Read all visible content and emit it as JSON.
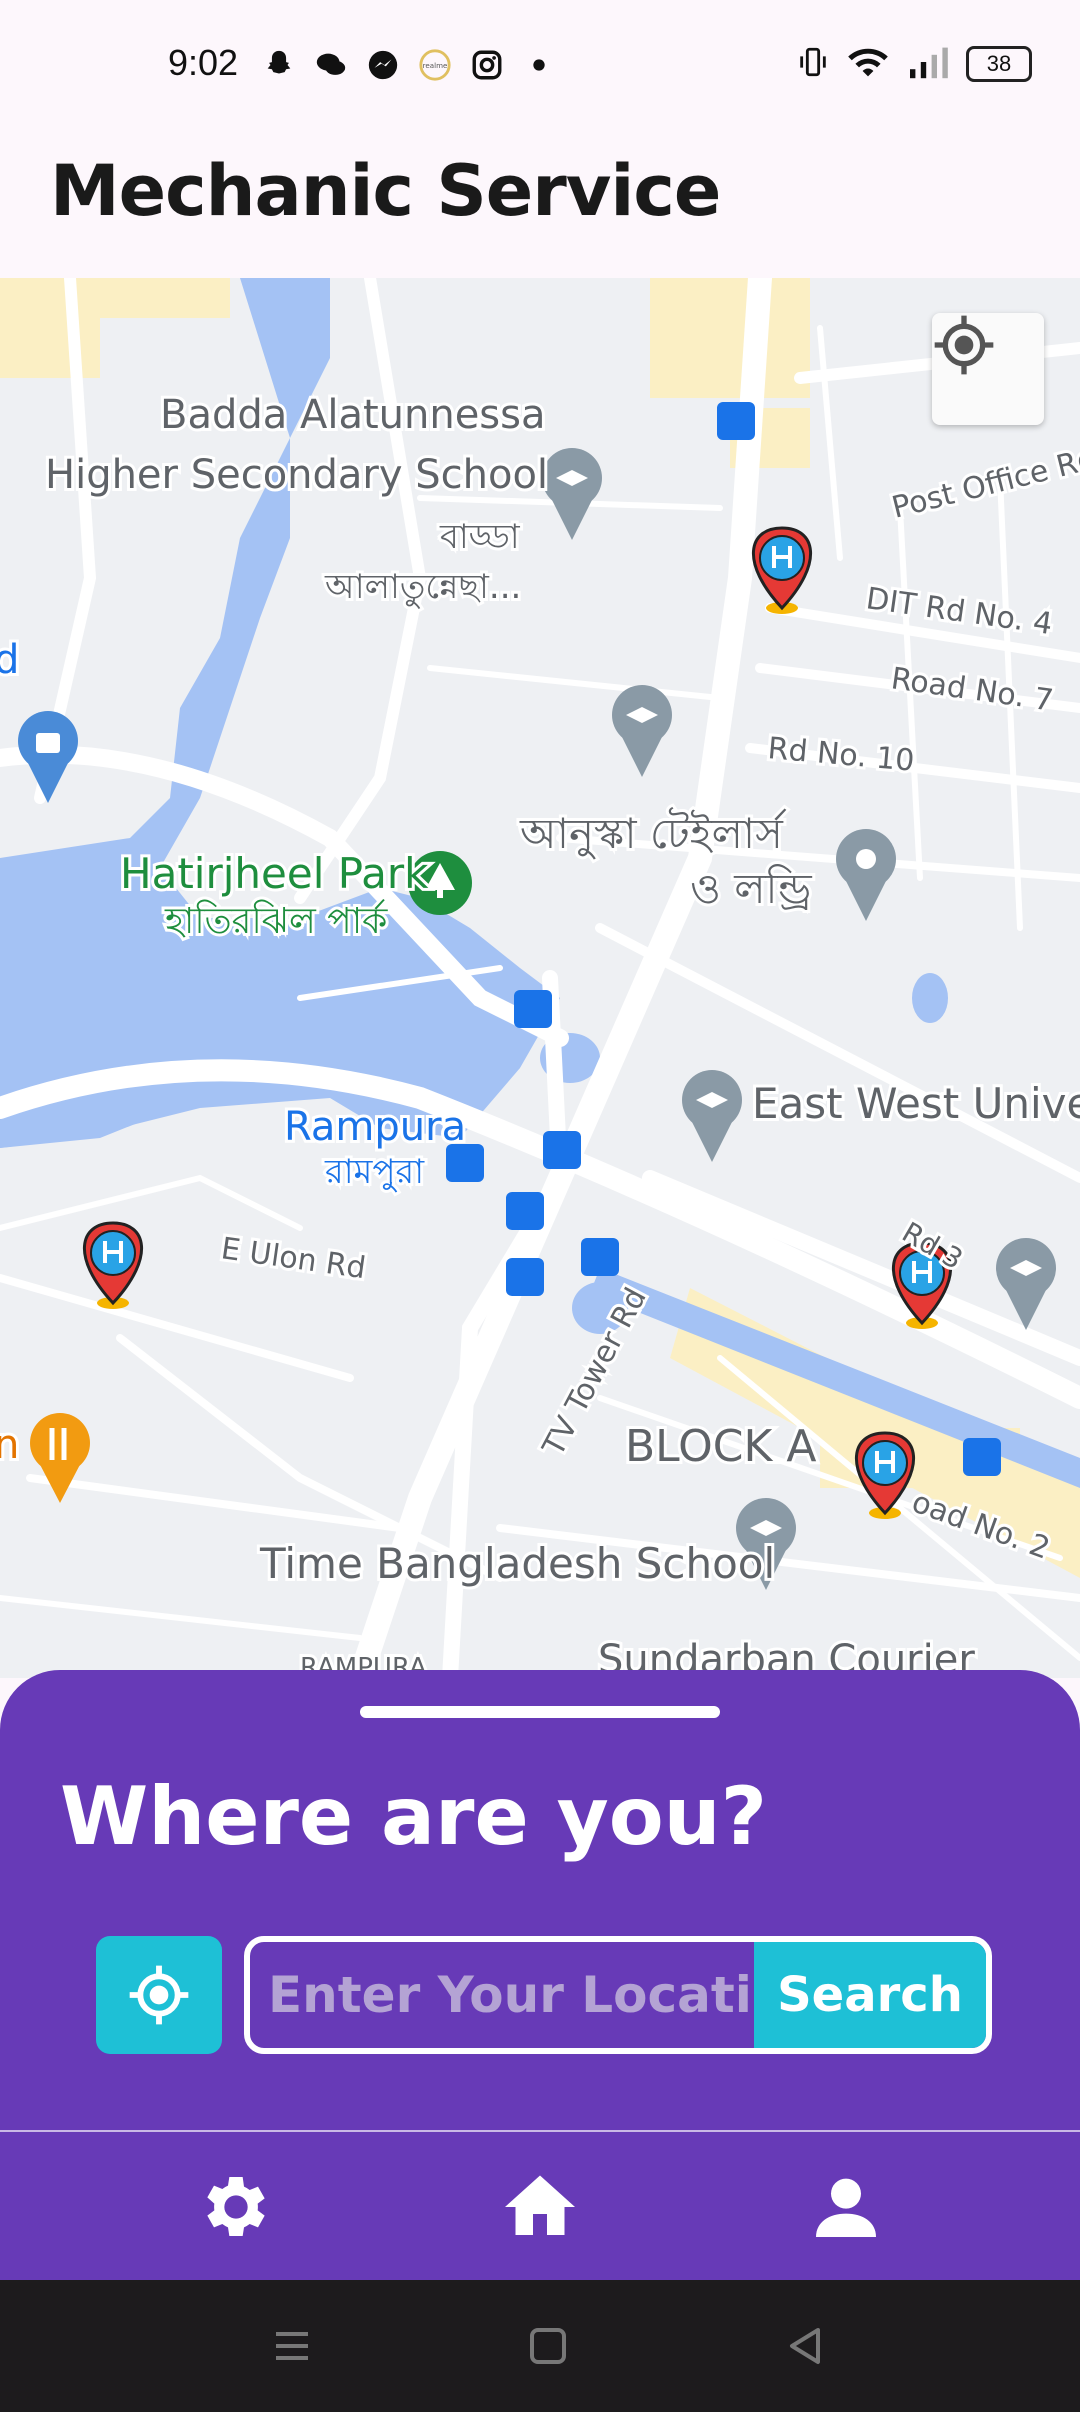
{
  "status_bar": {
    "time": "9:02",
    "battery": "38"
  },
  "app": {
    "title": "Mechanic Service"
  },
  "map": {
    "labels": {
      "school1": "Badda Alatunnessa",
      "school1b": "Higher Secondary School",
      "bn1": "বাড্ডা",
      "bn2": "আলাতুন্নেছা...",
      "post_office": "Post Office Rd",
      "dit": "DIT Rd No. 4",
      "road7": "Road No. 7",
      "rd10": "Rd No. 10",
      "tailors": "আনুস্কা টেইলার্স",
      "tailors2": "ও লন্ড্রি",
      "park": "Hatirjheel Park",
      "park_bn": "হাতিরঝিল পার্ক",
      "ewu": "East West Univers",
      "rampura": "Rampura",
      "rampura_bn": "রামপুরা",
      "ulon": "E Ulon Rd",
      "rd3": "Rd 3",
      "tv_tower": "TV Tower Rd",
      "block_a": "BLOCK A",
      "road2": "oad No. 2",
      "time_school": "Time Bangladesh School",
      "sundarban": "Sundarban Courier",
      "rampura_cut": "RAMPURA",
      "n_left": "n",
      "d_left": "d"
    },
    "colors": {
      "land": "#eef0f3",
      "water": "#a4c2f4",
      "road": "#ffffff",
      "park": "#1e8e3e",
      "pin_red": "#e53935",
      "pin_blue": "#1a73e8"
    }
  },
  "sheet": {
    "title": "Where are you?",
    "input_placeholder": "Enter Your Locati...",
    "search_label": "Search"
  },
  "nav": {
    "items": [
      "settings",
      "home",
      "profile"
    ]
  }
}
